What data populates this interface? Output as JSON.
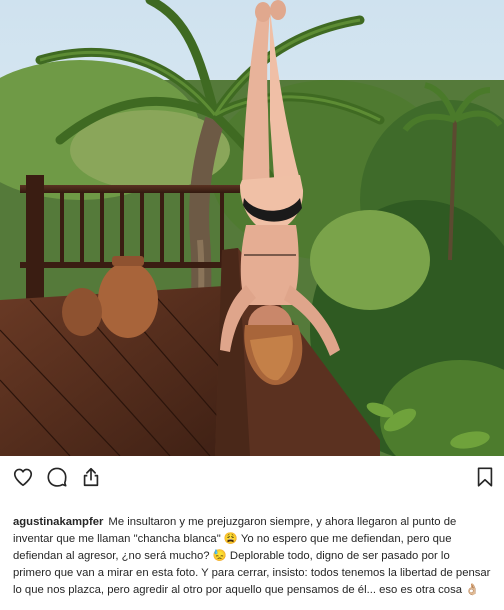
{
  "post": {
    "photo_alt": "",
    "actions": {
      "like_icon": "heart-icon",
      "comment_icon": "comment-icon",
      "share_icon": "share-icon",
      "save_icon": "bookmark-icon"
    },
    "caption": {
      "username": "agustinakampfer",
      "text": "Me insultaron y me prejuzgaron siempre, y ahora llegaron al punto de inventar que me llaman \"chancha blanca\" 😩 Yo no espero que me defiendan, pero que defiendan al agresor, ¿no será mucho? 😓 Deplorable todo, digno de ser pasado por lo primero que van a mirar en esta foto. Y para cerrar, insisto: todos tenemos la libertad de pensar lo que nos plazca, pero agredir al otro por aquello que pensamos de él... eso es otra cosa 👌🏼"
    }
  },
  "colors": {
    "text": "#262626",
    "background": "#ffffff",
    "icon": "#262626"
  }
}
